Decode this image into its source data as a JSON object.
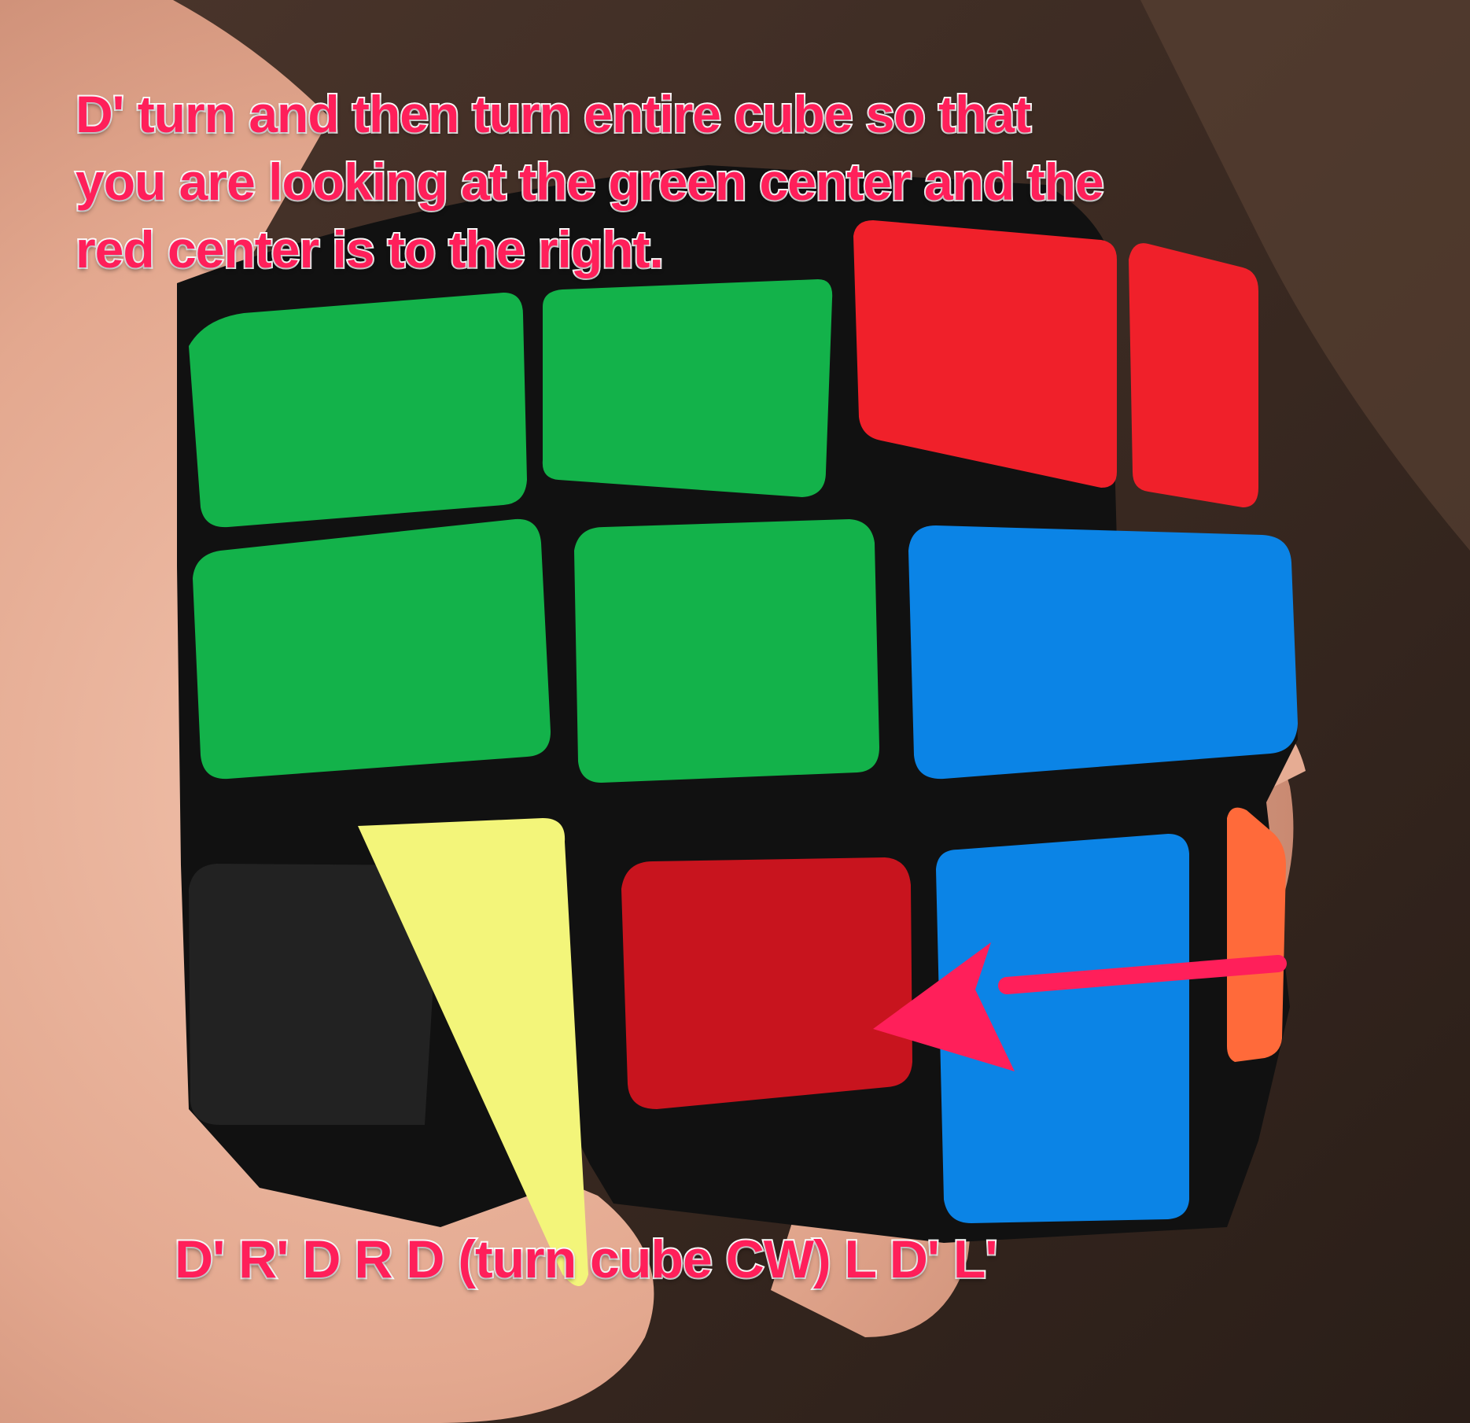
{
  "instruction": {
    "lines": [
      "D' turn and then turn entire cube so that",
      "you are looking at the green center and the",
      "red center is to the right."
    ]
  },
  "algorithm": "D' R' D R D (turn cube CW) L D' L'",
  "colors": {
    "annotation": "#ff1f5a",
    "annotation_outline": "#ffffff",
    "green": "#13b24a",
    "red": "#f0202a",
    "blue": "#0b84e6",
    "yellow": "#f3f57a",
    "orange": "#ff6a3a",
    "cube_body": "#111111"
  },
  "arrow": {
    "label": "pointer-arrow",
    "direction": "left"
  }
}
